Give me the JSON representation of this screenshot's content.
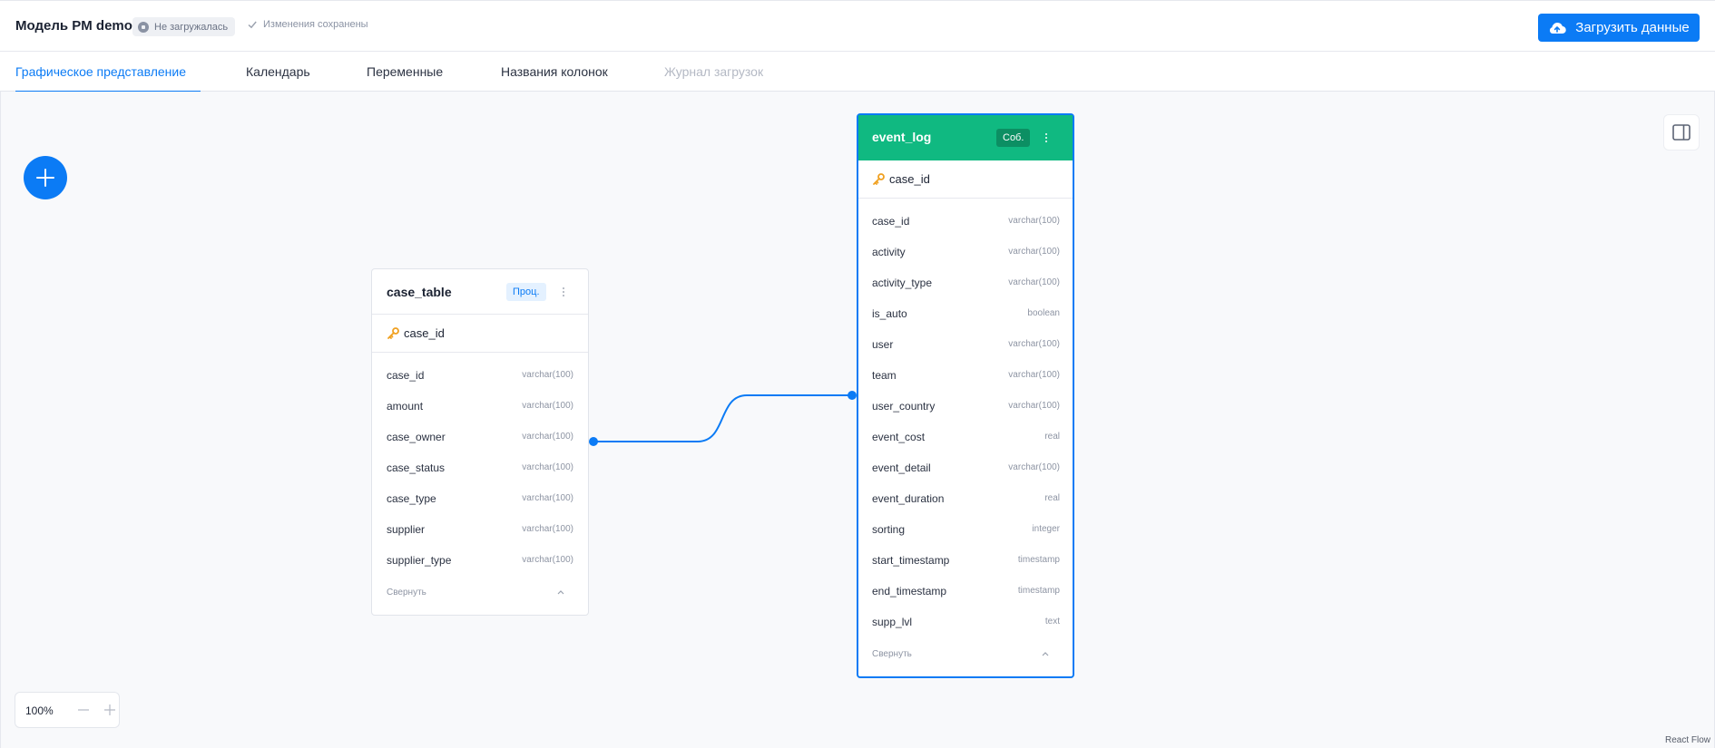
{
  "header": {
    "title": "Модель PM demo",
    "status_badge": "Не загружалась",
    "saved_status": "Изменения сохранены",
    "upload_button": "Загрузить данные"
  },
  "tabs": [
    {
      "label": "Графическое представление",
      "state": "active"
    },
    {
      "label": "Календарь",
      "state": "normal"
    },
    {
      "label": "Переменные",
      "state": "normal"
    },
    {
      "label": "Названия колонок",
      "state": "normal"
    },
    {
      "label": "Журнал загрузок",
      "state": "disabled"
    }
  ],
  "nodes": {
    "case_table": {
      "title": "case_table",
      "tag": "Проц.",
      "key": "case_id",
      "fields": [
        {
          "name": "case_id",
          "type": "varchar(100)"
        },
        {
          "name": "amount",
          "type": "varchar(100)"
        },
        {
          "name": "case_owner",
          "type": "varchar(100)"
        },
        {
          "name": "case_status",
          "type": "varchar(100)"
        },
        {
          "name": "case_type",
          "type": "varchar(100)"
        },
        {
          "name": "supplier",
          "type": "varchar(100)"
        },
        {
          "name": "supplier_type",
          "type": "varchar(100)"
        }
      ],
      "collapse_label": "Свернуть"
    },
    "event_log": {
      "title": "event_log",
      "tag": "Соб.",
      "key": "case_id",
      "fields": [
        {
          "name": "case_id",
          "type": "varchar(100)"
        },
        {
          "name": "activity",
          "type": "varchar(100)"
        },
        {
          "name": "activity_type",
          "type": "varchar(100)"
        },
        {
          "name": "is_auto",
          "type": "boolean"
        },
        {
          "name": "user",
          "type": "varchar(100)"
        },
        {
          "name": "team",
          "type": "varchar(100)"
        },
        {
          "name": "user_country",
          "type": "varchar(100)"
        },
        {
          "name": "event_cost",
          "type": "real"
        },
        {
          "name": "event_detail",
          "type": "varchar(100)"
        },
        {
          "name": "event_duration",
          "type": "real"
        },
        {
          "name": "sorting",
          "type": "integer"
        },
        {
          "name": "start_timestamp",
          "type": "timestamp"
        },
        {
          "name": "end_timestamp",
          "type": "timestamp"
        },
        {
          "name": "supp_lvl",
          "type": "text"
        }
      ],
      "collapse_label": "Свернуть"
    }
  },
  "zoom": {
    "value": "100%"
  },
  "attribution": "React Flow",
  "colors": {
    "accent": "#0b7bf5",
    "event_header": "#10b981",
    "event_tag": "#0c8f63",
    "proc_tag_bg": "#e4f1ff"
  },
  "icons": {
    "status": "stop-circle-icon",
    "saved": "check-icon",
    "upload": "cloud-upload-icon",
    "add": "plus-icon",
    "panel": "side-panel-icon",
    "key": "key-icon",
    "menu": "kebab-menu-icon",
    "collapse": "chevron-up-icon",
    "zoom_out": "minus-icon",
    "zoom_in": "plus-icon"
  }
}
